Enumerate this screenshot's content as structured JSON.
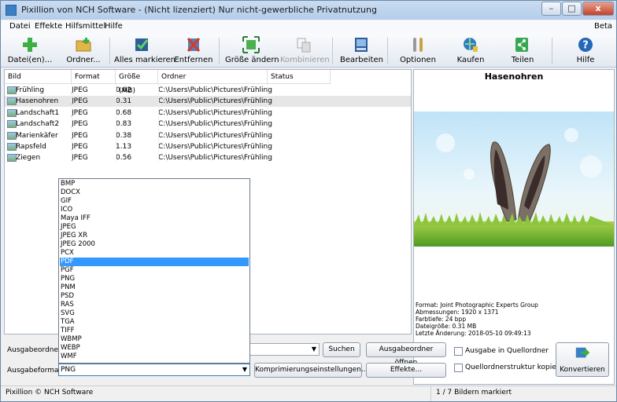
{
  "window": {
    "title": "Pixillion von NCH Software - (Nicht lizenziert) Nur nicht-gewerbliche Privatnutzung",
    "min": "–",
    "max": "□",
    "close": "x"
  },
  "menu": {
    "items": [
      "Datei",
      "Effekte",
      "Hilfsmittel",
      "Hilfe"
    ],
    "beta": "Beta"
  },
  "toolbar": {
    "buttons": [
      {
        "label": "Datei(en)...",
        "icon": "add-file-icon",
        "color": "#3cb043"
      },
      {
        "label": "Ordner...",
        "icon": "add-folder-icon",
        "color": "#d9a93a"
      },
      {
        "label": "Alles markieren",
        "icon": "check-all-icon",
        "color": "#2a8c3f"
      },
      {
        "label": "Entfernen",
        "icon": "remove-icon",
        "color": "#c8322a"
      },
      {
        "label": "Größe ändern",
        "icon": "resize-icon",
        "color": "#3b9c4a"
      },
      {
        "label": "Kombinieren",
        "icon": "combine-icon",
        "color": "#a8a8a8"
      },
      {
        "label": "Bearbeiten",
        "icon": "edit-icon",
        "color": "#2d5d9a"
      },
      {
        "label": "Optionen",
        "icon": "options-icon",
        "color": "#7a7a7a"
      },
      {
        "label": "Kaufen",
        "icon": "buy-icon",
        "color": "#2f7bc8"
      },
      {
        "label": "Teilen",
        "icon": "share-icon",
        "color": "#36a853"
      },
      {
        "label": "Hilfe",
        "icon": "help-icon",
        "color": "#2567b8"
      }
    ]
  },
  "list": {
    "columns": [
      "Bild",
      "Format",
      "Größe (MB)",
      "Ordner",
      "Status"
    ],
    "rows": [
      {
        "name": "Frühling",
        "format": "JPEG",
        "size": "0.62",
        "folder": "C:\\Users\\Public\\Pictures\\Frühling",
        "status": ""
      },
      {
        "name": "Hasenohren",
        "format": "JPEG",
        "size": "0.31",
        "folder": "C:\\Users\\Public\\Pictures\\Frühling",
        "status": ""
      },
      {
        "name": "Landschaft1",
        "format": "JPEG",
        "size": "0.68",
        "folder": "C:\\Users\\Public\\Pictures\\Frühling",
        "status": ""
      },
      {
        "name": "Landschaft2",
        "format": "JPEG",
        "size": "0.83",
        "folder": "C:\\Users\\Public\\Pictures\\Frühling",
        "status": ""
      },
      {
        "name": "Marienkäfer",
        "format": "JPEG",
        "size": "0.38",
        "folder": "C:\\Users\\Public\\Pictures\\Frühling",
        "status": ""
      },
      {
        "name": "Rapsfeld",
        "format": "JPEG",
        "size": "1.13",
        "folder": "C:\\Users\\Public\\Pictures\\Frühling",
        "status": ""
      },
      {
        "name": "Ziegen",
        "format": "JPEG",
        "size": "0.56",
        "folder": "C:\\Users\\Public\\Pictures\\Frühling",
        "status": ""
      }
    ],
    "selected_index": 1
  },
  "format_options": [
    "BMP",
    "DOCX",
    "GIF",
    "ICO",
    "Maya IFF",
    "JPEG",
    "JPEG XR",
    "JPEG 2000",
    "PCX",
    "PDF",
    "PGF",
    "PNG",
    "PNM",
    "PSD",
    "RAS",
    "SVG",
    "TGA",
    "TIFF",
    "WBMP",
    "WEBP",
    "WMF"
  ],
  "format_highlighted": "PDF",
  "preview": {
    "title": "Hasenohren",
    "meta": [
      "Format: Joint Photographic Experts Group",
      "Abmessungen: 1920 x 1371",
      "Farbtiefe: 24 bpp",
      "Dateigröße: 0.31 MB",
      "Letzte Änderung: 2018-05-10 09:49:13"
    ]
  },
  "output": {
    "folder_label": "Ausgabeordner:",
    "folder_value": "",
    "search_button": "Suchen",
    "open_folder_button": "Ausgabeordner öffnen",
    "format_label": "Ausgabeformat:",
    "format_value": "PNG",
    "compression_button": "Komprimierungseinstellungen...",
    "effects_button": "Effekte...",
    "checkbox_source_folder": "Ausgabe in Quellordner",
    "checkbox_copy_structure": "Quellordnerstruktur kopieren",
    "convert_button": "Konvertieren"
  },
  "status": {
    "left": "Pixillion © NCH Software",
    "right": "1 / 7 Bildern markiert"
  }
}
